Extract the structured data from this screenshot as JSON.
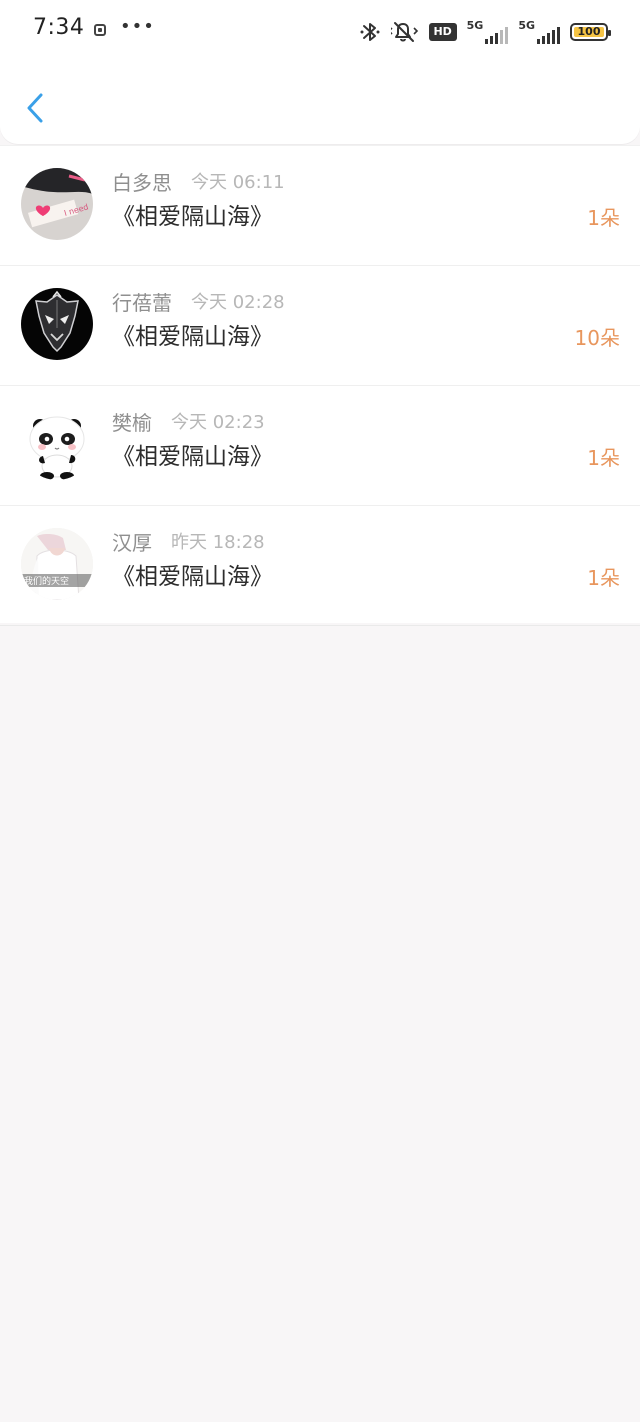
{
  "status_bar": {
    "time": "7:34",
    "hd_label": "HD",
    "network_primary": "5G",
    "network_secondary": "5G",
    "battery_level": "100",
    "more_label": "•••",
    "battery_color": "#f5c445"
  },
  "header": {
    "back_icon": "chevron-left-icon",
    "accent_color": "#3aa0e8"
  },
  "messages": [
    {
      "name": "白多思",
      "time": "今天 06:11",
      "title": "《相爱隔山海》",
      "count": "1朵",
      "avatar_icon": "heart-photo-avatar"
    },
    {
      "name": "行蓓蕾",
      "time": "今天 02:28",
      "title": "《相爱隔山海》",
      "count": "10朵",
      "avatar_icon": "dark-mask-avatar"
    },
    {
      "name": "樊榆",
      "time": "今天 02:23",
      "title": "《相爱隔山海》",
      "count": "1朵",
      "avatar_icon": "panda-avatar"
    },
    {
      "name": "汉厚",
      "time": "昨天 18:28",
      "title": "《相爱隔山海》",
      "count": "1朵",
      "avatar_icon": "portrait-avatar",
      "avatar_caption": "我们的天空"
    }
  ],
  "colors": {
    "background": "#f8f6f7",
    "count_color": "#e8965d",
    "name_color": "#8f8f8f"
  }
}
